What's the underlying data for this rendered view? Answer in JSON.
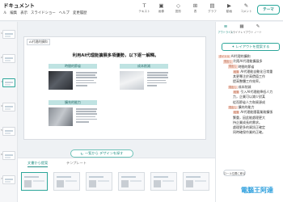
{
  "header": {
    "doc_title": "ドキュメント",
    "menu": [
      "ル",
      "編集",
      "表示",
      "スライドショー",
      "ヘルプ",
      "変更履歴"
    ],
    "tools": [
      {
        "icon": "text-icon",
        "glyph": "T",
        "label": "テキスト"
      },
      {
        "icon": "image-icon",
        "glyph": "▣",
        "label": "画像"
      },
      {
        "icon": "shape-icon",
        "glyph": "◇",
        "label": "図形"
      },
      {
        "icon": "table-icon",
        "glyph": "⊞",
        "label": "表"
      },
      {
        "icon": "chart-icon",
        "glyph": "▤",
        "label": "グラフ"
      },
      {
        "icon": "video-icon",
        "glyph": "▶",
        "label": "動画"
      },
      {
        "icon": "comment-icon",
        "glyph": "✎",
        "label": "コメント"
      }
    ],
    "theme_button": "テーマ"
  },
  "thumbnails": [
    "1",
    "2",
    "3",
    "4",
    "5",
    "6",
    "7"
  ],
  "slide": {
    "tag": "AI代理的擴和",
    "heading": "利用AI代理能擴展多項優勢，以下逐一解釋。",
    "blocks": [
      {
        "label": "時間的節省",
        "photo": "p1"
      },
      {
        "label": "成本削減",
        "photo": "p2"
      },
      {
        "label": "擴充的能力",
        "photo": "p3"
      }
    ]
  },
  "redo_button": "一覧から デザインを探す",
  "bottom_panel": {
    "tabs": [
      "文書から提案",
      "テンプレート"
    ],
    "cards": [
      "1",
      "2",
      "3",
      "4",
      "5",
      "6"
    ]
  },
  "right_panel": {
    "icons": [
      {
        "icon": "outline-icon",
        "glyph": "≡",
        "label": "アウトライン"
      },
      {
        "icon": "layout-icon",
        "glyph": "▦",
        "label": "スライドレイアウト"
      },
      {
        "icon": "note-icon",
        "glyph": "✎",
        "label": "ノート"
      }
    ],
    "layout_button": "✦ レイアウトを提案する",
    "outline": [
      {
        "tag": "タイトル",
        "text": "AI代理的擴和",
        "depth": 0
      },
      {
        "tag": "見出し",
        "text": "利用AI代理能擴展多",
        "depth": 1
      },
      {
        "tag": "見出し",
        "text": "時間的節省",
        "depth": 2
      },
      {
        "tag": "段落",
        "text": "AI代理能自動化日常重",
        "depth": 3
      },
      {
        "tag": "",
        "text": "其更專注於高價值工作",
        "depth": 3
      },
      {
        "tag": "",
        "text": "提高整體工作效率。",
        "depth": 3
      },
      {
        "tag": "見出し",
        "text": "成本削減",
        "depth": 2
      },
      {
        "tag": "段落",
        "text": "引入AI代理能降低人力",
        "depth": 3
      },
      {
        "tag": "",
        "text": "力，企業可以減少對某",
        "depth": 3
      },
      {
        "tag": "",
        "text": "從而節省人力和資源成",
        "depth": 3
      },
      {
        "tag": "見出し",
        "text": "擴充的能力",
        "depth": 2
      },
      {
        "tag": "段落",
        "text": "AI代理能隨著業務擴張",
        "depth": 3
      },
      {
        "tag": "",
        "text": "繁重，因此能處理更大",
        "depth": 3
      },
      {
        "tag": "",
        "text": "持企業成長的需求。",
        "depth": 3
      },
      {
        "tag": "",
        "text": "處理更多的資訊正確定",
        "depth": 3
      },
      {
        "tag": "",
        "text": "同時確保作業的正確。",
        "depth": 3
      }
    ],
    "scroll_button": "ロール位置に移る"
  },
  "watermark": "電腦王阿達"
}
